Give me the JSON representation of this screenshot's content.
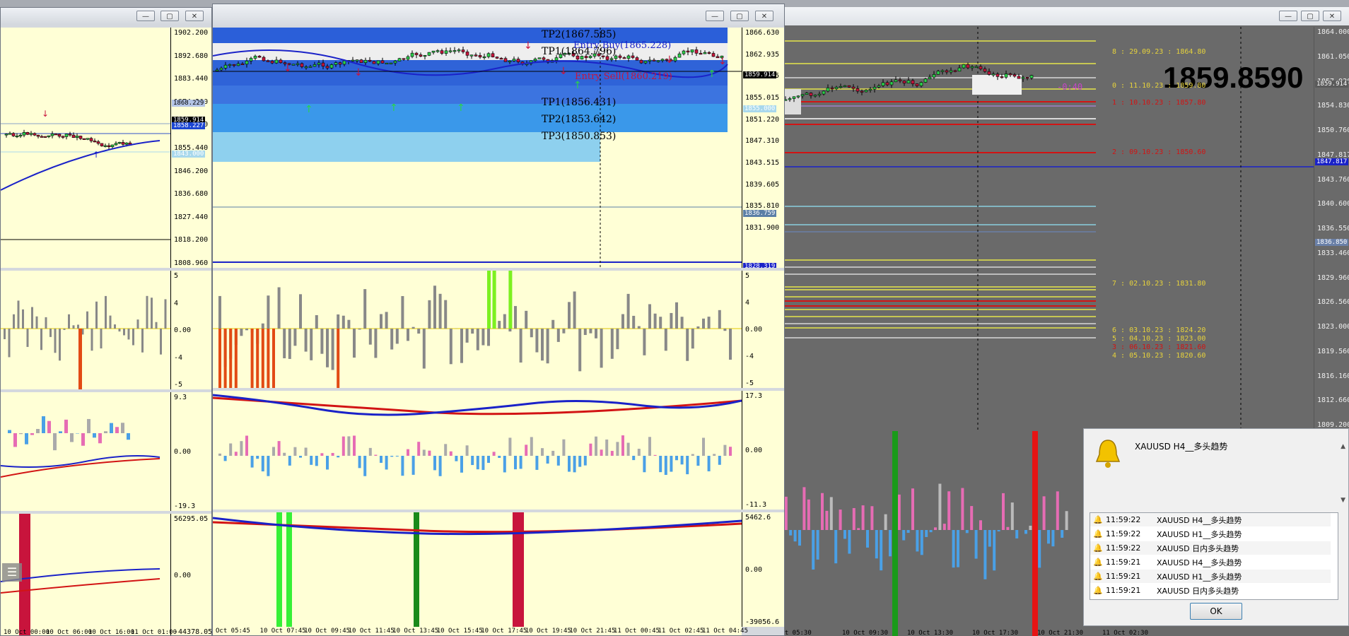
{
  "colors": {
    "chart_bg": "#ffffd6",
    "dark_bg": "#6a6a6a",
    "bull": "#2bd24a",
    "bear": "#c8143c",
    "ma_blue": "#1a22c8",
    "ma_red": "#d21414"
  },
  "window1": {
    "price_ticks": [
      "1902.200",
      "1892.680",
      "1883.440",
      "1874.200",
      "1864.680",
      "1855.440",
      "1846.200",
      "1836.680",
      "1827.440",
      "1818.200",
      "1808.960"
    ],
    "tags": [
      {
        "text": "1868.229",
        "bg": "#b4c4e6",
        "fg": "#000"
      },
      {
        "text": "1859.914",
        "bg": "#000000",
        "fg": "#fff"
      },
      {
        "text": "1858.227",
        "bg": "#1c46d2",
        "fg": "#fff"
      },
      {
        "text": "1843.000",
        "bg": "#a8d8ec",
        "fg": "#fff"
      }
    ],
    "osc1_ticks": [
      "5",
      "4",
      "0.00",
      "-4",
      "-5"
    ],
    "osc2_ticks": [
      "9.3",
      "0.00",
      "-19.3"
    ],
    "osc3_ticks": [
      "56295.05",
      "0.00",
      "-44378.05"
    ],
    "xaxis": [
      "10 Oct 00:00",
      "10 Oct 06:00",
      "10 Oct 16:00",
      "11 Oct 01:00"
    ]
  },
  "window2": {
    "tp_labels": [
      "TP2(1867.585)",
      "TP1(1864.796)",
      "TP1(1856.431)",
      "TP2(1853.642)",
      "TP3(1850.853)"
    ],
    "entry_buy": "Entry Buy(1865.228)",
    "entry_sell": "Entry Sell(1860.219)",
    "price_ticks": [
      "1866.630",
      "1862.935",
      "1858.925",
      "1855.015",
      "1851.220",
      "1847.310",
      "1843.515",
      "1839.605",
      "1835.810",
      "1831.900"
    ],
    "tags": [
      {
        "text": "1859.914",
        "bg": "#000000",
        "fg": "#fff"
      },
      {
        "text": "1855.000",
        "bg": "#a8d8ec",
        "fg": "#fff"
      },
      {
        "text": "1836.759",
        "bg": "#5b7fa6",
        "fg": "#fff"
      },
      {
        "text": "1828.319",
        "bg": "#1a22c8",
        "fg": "#fff"
      }
    ],
    "osc1_ticks": [
      "5",
      "4",
      "0.00",
      "-4",
      "-5"
    ],
    "osc2_ticks": [
      "17.3",
      "0.00",
      "-11.3"
    ],
    "osc3_ticks": [
      "5462.6",
      "0.00",
      "-39056.6"
    ],
    "xaxis": [
      "Oct 05:45",
      "10 Oct 07:45",
      "10 Oct 09:45",
      "10 Oct 11:45",
      "10 Oct 13:45",
      "10 Oct 15:45",
      "10 Oct 17:45",
      "10 Oct 19:45",
      "10 Oct 21:45",
      "11 Oct 00:45",
      "11 Oct 02:45",
      "11 Oct 04:45"
    ]
  },
  "window3": {
    "big_price": "1859.8590",
    "small_label": "-0:40",
    "price_ticks": [
      "1864.000",
      "1861.050",
      "1857.920",
      "1854.830",
      "1850.760",
      "1847.817",
      "1843.760",
      "1840.600",
      "1836.550",
      "1833.460",
      "1829.960",
      "1826.560",
      "1823.000",
      "1819.560",
      "1816.160",
      "1812.660",
      "1809.200"
    ],
    "tags": [
      {
        "text": "1859.914",
        "bg": "#5a5a5a",
        "fg": "#fff"
      },
      {
        "text": "1847.817",
        "bg": "#1a22c8",
        "fg": "#fff"
      },
      {
        "text": "1836.850",
        "bg": "#6a80a8",
        "fg": "#fff"
      }
    ],
    "levels": [
      {
        "text": "8 : 29.09.23 : 1864.80",
        "color": "#e6d23c"
      },
      {
        "text": "0 : 11.10.23 : 1859.80",
        "color": "#e6d23c"
      },
      {
        "text": "1 : 10.10.23 : 1857.80",
        "color": "#d21414"
      },
      {
        "text": "2 : 09.10.23 : 1850.60",
        "color": "#d21414"
      },
      {
        "text": "7 : 02.10.23 : 1831.80",
        "color": "#e6d23c"
      },
      {
        "text": "6 : 03.10.23 : 1824.20",
        "color": "#e6d23c"
      },
      {
        "text": "5 : 04.10.23 : 1823.00",
        "color": "#e6d23c"
      },
      {
        "text": "3 : 06.10.23 : 1821.60",
        "color": "#d21414"
      },
      {
        "text": "4 : 05.10.23 : 1820.60",
        "color": "#e6d23c"
      }
    ],
    "xaxis": [
      "Oct 05:30",
      "10 Oct 09:30",
      "10 Oct 13:30",
      "10 Oct 17:30",
      "10 Oct 21:30",
      "11 Oct 02:30"
    ]
  },
  "alert": {
    "message": "XAUUSD  H4__多头趋势",
    "rows": [
      {
        "time": "11:59:22",
        "text": "XAUUSD  H4__多头趋势"
      },
      {
        "time": "11:59:22",
        "text": "XAUUSD  H1__多头趋势"
      },
      {
        "time": "11:59:22",
        "text": "XAUUSD  日内多头趋势"
      },
      {
        "time": "11:59:21",
        "text": "XAUUSD  H4__多头趋势"
      },
      {
        "time": "11:59:21",
        "text": "XAUUSD  H1__多头趋势"
      },
      {
        "time": "11:59:21",
        "text": "XAUUSD  日内多头趋势"
      }
    ],
    "ok": "OK"
  },
  "window_buttons": {
    "minimize": "—",
    "maximize": "▢",
    "close": "✕"
  }
}
